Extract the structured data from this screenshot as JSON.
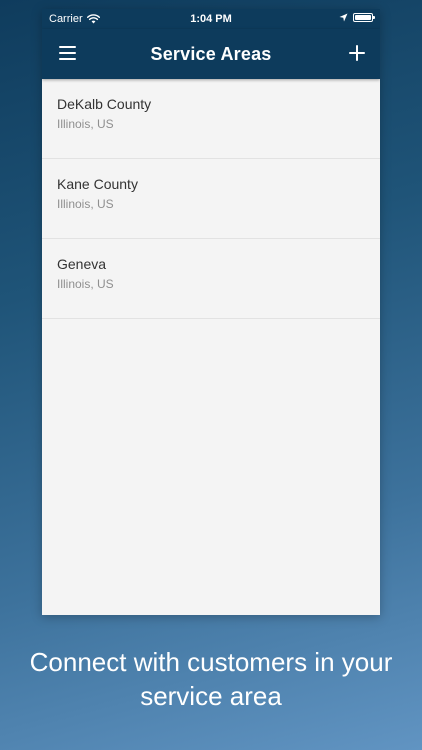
{
  "status_bar": {
    "carrier": "Carrier",
    "time": "1:04 PM",
    "icons": [
      "wifi-icon",
      "location-arrow-icon",
      "battery-icon"
    ]
  },
  "nav": {
    "title": "Service Areas",
    "left_icon": "menu-icon",
    "right_icon": "add-icon"
  },
  "service_areas": [
    {
      "name": "DeKalb County",
      "location": "Illinois, US"
    },
    {
      "name": "Kane County",
      "location": "Illinois, US"
    },
    {
      "name": "Geneva",
      "location": "Illinois, US"
    }
  ],
  "caption": "Connect with customers in your service area",
  "colors": {
    "nav_background": "#0d3b5c",
    "list_background": "#f4f4f4",
    "background_gradient_start": "#0f3c5d",
    "background_gradient_end": "#6194c2"
  }
}
